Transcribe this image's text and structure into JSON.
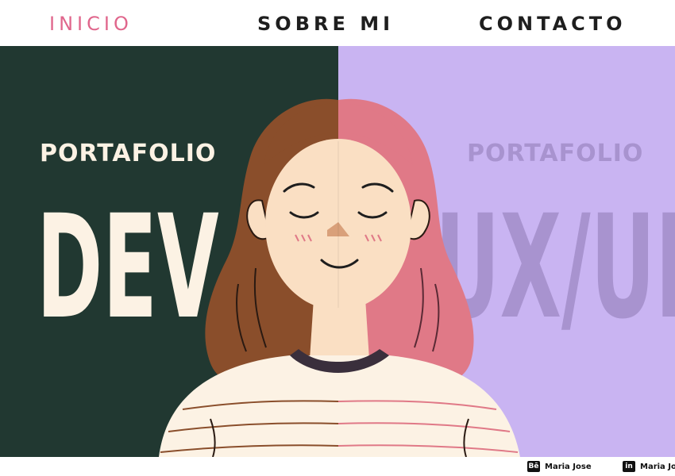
{
  "nav": {
    "items": [
      {
        "label": "INICIO",
        "active": true
      },
      {
        "label": "SOBRE MI",
        "active": false
      },
      {
        "label": "CONTACTO",
        "active": false
      }
    ]
  },
  "hero": {
    "left": {
      "label": "PORTAFOLIO",
      "word": "DEV",
      "background": "#213831",
      "text_color": "#fcf2e4"
    },
    "right": {
      "label": "PORTAFOLIO",
      "word": "UX/UI",
      "background": "#c9b4f2",
      "text_color": "#a893cf"
    }
  },
  "footer": {
    "social": [
      {
        "icon": "behance-icon",
        "badge": "Bē",
        "name": "Maria Jose"
      },
      {
        "icon": "linkedin-icon",
        "badge": "in",
        "name": "Maria Jose"
      }
    ]
  },
  "colors": {
    "accent_pink": "#e0668c",
    "hair_brown": "#8a4e2b",
    "hair_pink": "#e07987",
    "skin": "#fadfc3"
  }
}
